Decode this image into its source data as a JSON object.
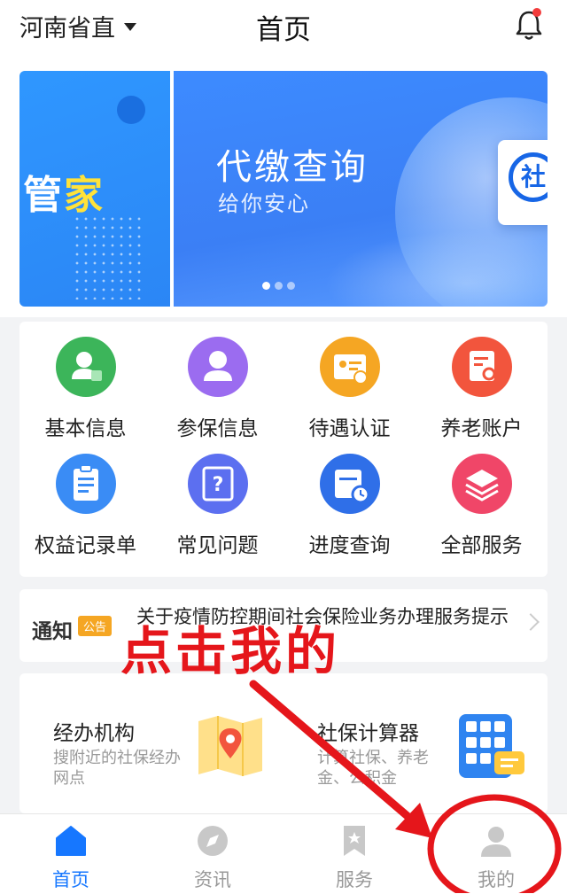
{
  "header": {
    "region": "河南省直",
    "title": "首页"
  },
  "banner": {
    "left_text_main": "管",
    "left_text_highlight": "家",
    "headline": "代缴查询",
    "subline": "给你安心",
    "chip_char": "社",
    "pages": 3,
    "active_page": 1
  },
  "services": [
    {
      "label": "基本信息",
      "icon": "user-card-icon",
      "color": "#3cb55a"
    },
    {
      "label": "参保信息",
      "icon": "person-icon",
      "color": "#9b6cf0"
    },
    {
      "label": "待遇认证",
      "icon": "id-verify-icon",
      "color": "#f5a623"
    },
    {
      "label": "养老账户",
      "icon": "account-doc-icon",
      "color": "#f2553d"
    },
    {
      "label": "权益记录单",
      "icon": "clipboard-icon",
      "color": "#3a8cf5"
    },
    {
      "label": "常见问题",
      "icon": "question-doc-icon",
      "color": "#5c6ff0"
    },
    {
      "label": "进度查询",
      "icon": "calendar-clock-icon",
      "color": "#2f6fe8"
    },
    {
      "label": "全部服务",
      "icon": "layers-icon",
      "color": "#f04668"
    }
  ],
  "notice": {
    "label": "通知",
    "badge": "公告",
    "text": "关于疫情防控期间社会保险业务办理服务提示"
  },
  "cards": [
    {
      "title": "经办机构",
      "desc": "搜附近的社保经办网点",
      "icon": "map-pin-icon"
    },
    {
      "title": "社保计算器",
      "desc": "计算社保、养老金、公积金",
      "icon": "calculator-icon"
    }
  ],
  "tabs": [
    {
      "label": "首页",
      "icon": "home-icon",
      "active": true
    },
    {
      "label": "资讯",
      "icon": "compass-icon",
      "active": false
    },
    {
      "label": "服务",
      "icon": "bookmark-icon",
      "active": false
    },
    {
      "label": "我的",
      "icon": "profile-icon",
      "active": false
    }
  ],
  "annotation": {
    "text": "点击我的",
    "color": "#e5161b"
  }
}
